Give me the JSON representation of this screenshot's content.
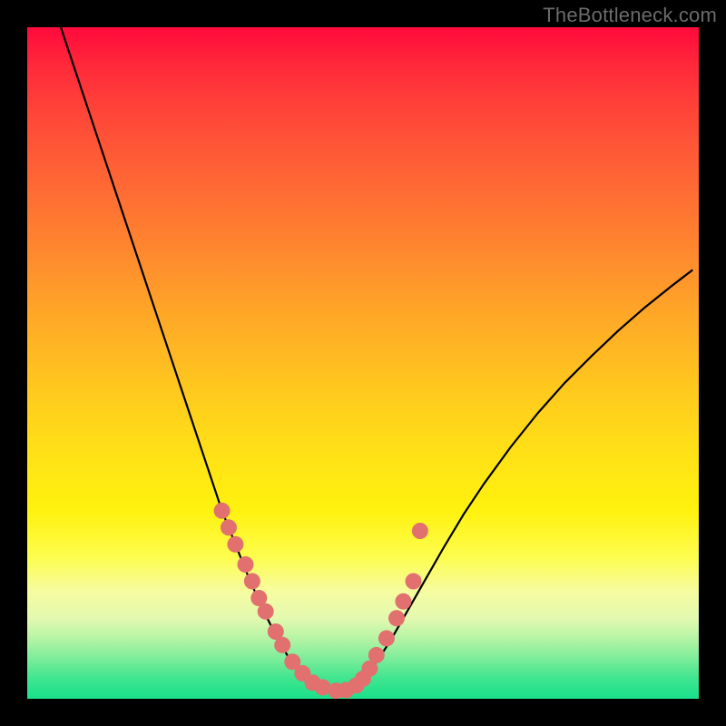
{
  "brand": {
    "text": "TheBottleneck.com"
  },
  "colors": {
    "marker_fill": "#e1706f",
    "curve_stroke": "#000000"
  },
  "chart_data": {
    "type": "line",
    "title": "",
    "xlabel": "",
    "ylabel": "",
    "xlim": [
      0,
      100
    ],
    "ylim": [
      0,
      100
    ],
    "grid": false,
    "legend": false,
    "series": [
      {
        "name": "bottleneck-curve",
        "x": [
          5,
          7,
          9,
          11,
          13,
          15,
          17,
          19,
          21,
          23,
          25,
          27,
          29,
          31,
          33,
          35,
          37,
          39,
          40.5,
          42,
          44,
          46,
          48,
          50,
          52,
          54,
          56,
          58,
          60,
          62,
          65,
          68,
          72,
          76,
          80,
          84,
          88,
          92,
          96,
          99
        ],
        "y": [
          100,
          94,
          88,
          82,
          76,
          70,
          64,
          58,
          52,
          46,
          40,
          34,
          28,
          23,
          18,
          13.5,
          9.5,
          6,
          4,
          2.7,
          1.8,
          1.2,
          1.5,
          3,
          5.5,
          8.5,
          12,
          15.5,
          19,
          22.5,
          27.5,
          32,
          37.5,
          42.5,
          47,
          51,
          54.8,
          58.3,
          61.5,
          63.8
        ]
      }
    ],
    "markers": {
      "name": "benchmark-points",
      "x": [
        29,
        30,
        31,
        32.5,
        33.5,
        34.5,
        35.5,
        37,
        38,
        39.5,
        41,
        42.5,
        44,
        46,
        47.5,
        49,
        50,
        51,
        52,
        53.5,
        55,
        56,
        57.5,
        58.5
      ],
      "y": [
        28,
        25.5,
        23,
        20,
        17.5,
        15,
        13,
        10,
        8,
        5.5,
        3.8,
        2.4,
        1.7,
        1.2,
        1.3,
        2,
        3,
        4.5,
        6.5,
        9,
        12,
        14.5,
        17.5,
        25
      ]
    }
  }
}
